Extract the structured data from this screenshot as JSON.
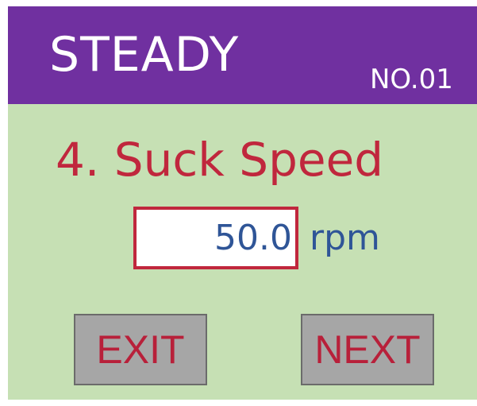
{
  "header": {
    "title": "STEADY",
    "number": "NO.01"
  },
  "step": {
    "title": "4. Suck Speed"
  },
  "parameter": {
    "value": "50.0",
    "unit": "rpm"
  },
  "buttons": {
    "exit_label": "EXIT",
    "next_label": "NEXT"
  },
  "colors": {
    "header_bg": "#7030a0",
    "screen_bg": "#c6e0b4",
    "title_red": "#c0273d",
    "value_blue": "#2f5597",
    "button_gray": "#a6a6a6"
  }
}
